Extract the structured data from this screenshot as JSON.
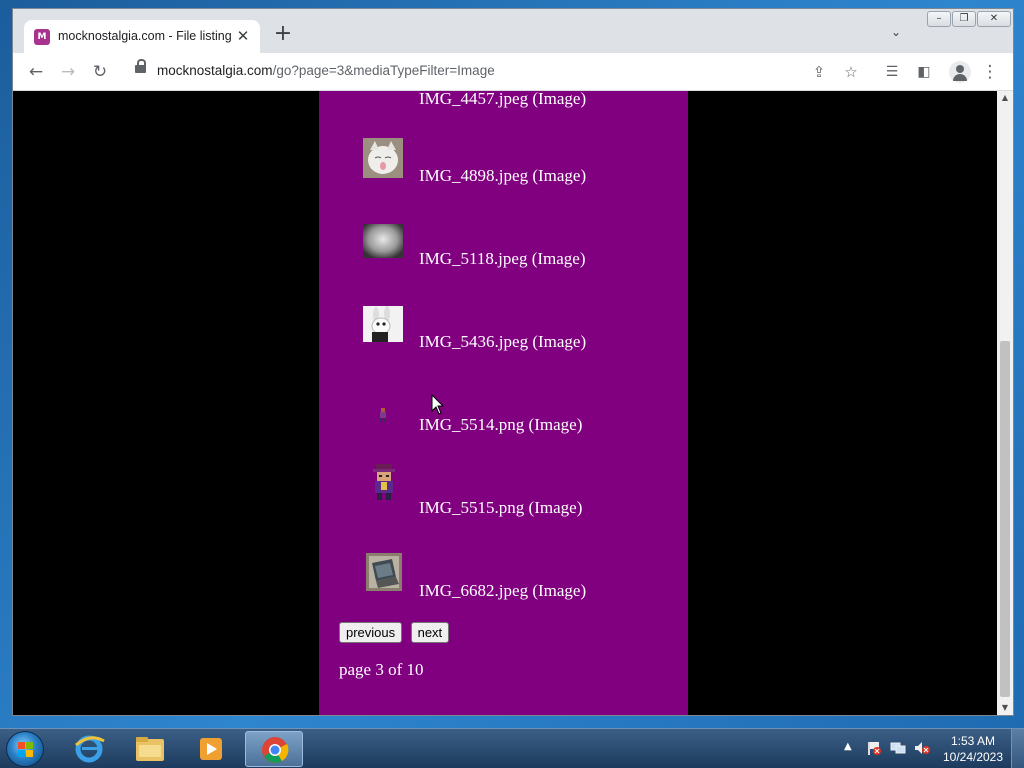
{
  "browser": {
    "tab_title": "mocknostalgia.com - File listing",
    "favicon_label": "M",
    "url_host": "mocknostalgia.com",
    "url_rest": "/go?page=3&mediaTypeFilter=Image"
  },
  "files": [
    {
      "name": "IMG_4457.jpeg (Image)",
      "thumb": "none"
    },
    {
      "name": "IMG_4898.jpeg (Image)",
      "thumb": "cat"
    },
    {
      "name": "IMG_5118.jpeg (Image)",
      "thumb": "gray-blur"
    },
    {
      "name": "IMG_5436.jpeg (Image)",
      "thumb": "rabbid"
    },
    {
      "name": "IMG_5514.png (Image)",
      "thumb": "tiny-sprite"
    },
    {
      "name": "IMG_5515.png (Image)",
      "thumb": "pixel-character"
    },
    {
      "name": "IMG_6682.jpeg (Image)",
      "thumb": "laptop-photo"
    }
  ],
  "pager": {
    "previous_label": "previous",
    "next_label": "next",
    "page_info": "page 3 of 10"
  },
  "taskbar": {
    "time": "1:53 AM",
    "date": "10/24/2023"
  },
  "colors": {
    "page_bg": "#000000",
    "content_bg": "#800080",
    "text": "#ffffff"
  }
}
